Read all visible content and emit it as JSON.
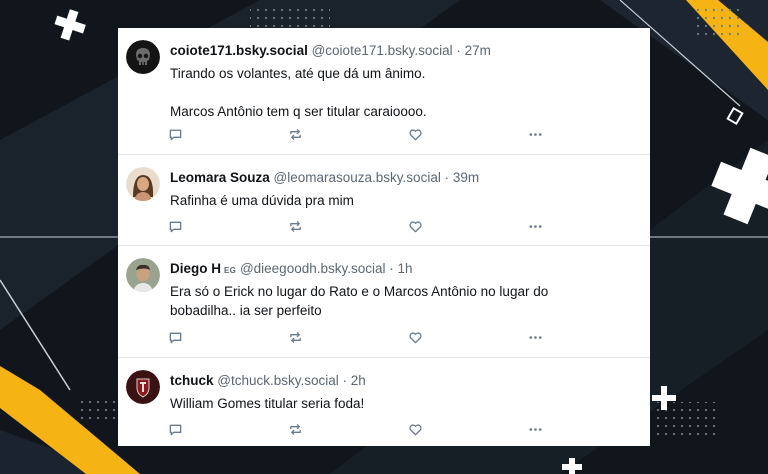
{
  "colors": {
    "background": "#10161c",
    "accent_yellow": "#f5b414",
    "card": "#ffffff",
    "text": "#101418",
    "muted": "#5b6773",
    "icon": "#6a7a8c"
  },
  "posts": [
    {
      "display_name": "coiote171.bsky.social",
      "handle": "@coiote171.bsky.social",
      "time": "· 27m",
      "text": "Tirando os volantes, até que dá um ânimo.\n\nMarcos Antônio tem q ser titular caraioooo.",
      "avatar_icon": "skull-avatar-icon"
    },
    {
      "display_name": "Leomara Souza",
      "handle": "@leomarasouza.bsky.social",
      "time": "· 39m",
      "text": "Rafinha é uma dúvida pra mim",
      "avatar_icon": "person-avatar-icon"
    },
    {
      "display_name": "Diego H",
      "badge": "EG",
      "handle": "@dieegoodh.bsky.social",
      "time": "· 1h",
      "text": "Era só o Erick no lugar do Rato e o Marcos Antônio no lugar do\nbobadilha.. ia ser perfeito",
      "avatar_icon": "person-avatar-icon"
    },
    {
      "display_name": "tchuck",
      "handle": "@tchuck.bsky.social",
      "time": "· 2h",
      "text": "William Gomes titular seria foda!",
      "avatar_icon": "logo-avatar-icon"
    }
  ]
}
